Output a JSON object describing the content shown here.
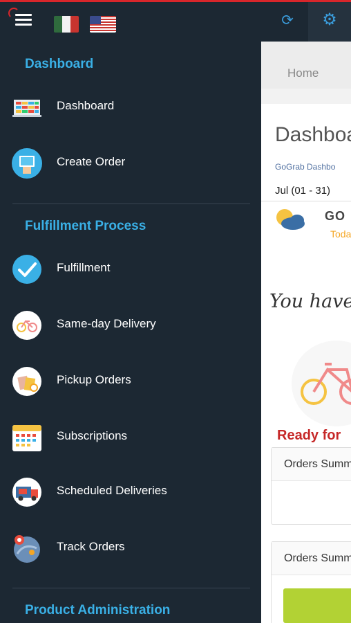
{
  "topbar": {
    "flags": [
      "mexico-flag",
      "usa-flag"
    ],
    "icons": [
      "menu-icon",
      "sync-icon",
      "gear-icon"
    ]
  },
  "sidebar": {
    "sections": [
      {
        "title": "Dashboard"
      },
      {
        "title": "Fulfillment Process"
      },
      {
        "title": "Product Administration"
      }
    ],
    "items": [
      {
        "label": "Dashboard",
        "icon": "dashboard-icon"
      },
      {
        "label": "Create Order",
        "icon": "create-order-icon"
      },
      {
        "label": "Fulfillment",
        "icon": "checkmark-icon"
      },
      {
        "label": "Same-day Delivery",
        "icon": "bicycle-icon"
      },
      {
        "label": "Pickup Orders",
        "icon": "shopping-bag-icon"
      },
      {
        "label": "Subscriptions",
        "icon": "calendar-icon"
      },
      {
        "label": "Scheduled Deliveries",
        "icon": "delivery-truck-icon"
      },
      {
        "label": "Track Orders",
        "icon": "map-pin-icon"
      }
    ]
  },
  "content": {
    "breadcrumb": "Home",
    "page_title": "Dashboa",
    "subtitle": "GoGrab Dashbo",
    "date_range": "Jul (01 - 31)",
    "brand_name": "GO",
    "brand_sub": "Toda",
    "message": "You have y",
    "ready_text": "Ready for",
    "cards": [
      {
        "title": "Orders Summ"
      },
      {
        "title": "Orders Summ"
      }
    ]
  },
  "colors": {
    "sidebar_bg": "#1c2833",
    "accent_blue": "#3ab0e6",
    "ready_red": "#c62828",
    "green_bar": "#b2d234"
  }
}
